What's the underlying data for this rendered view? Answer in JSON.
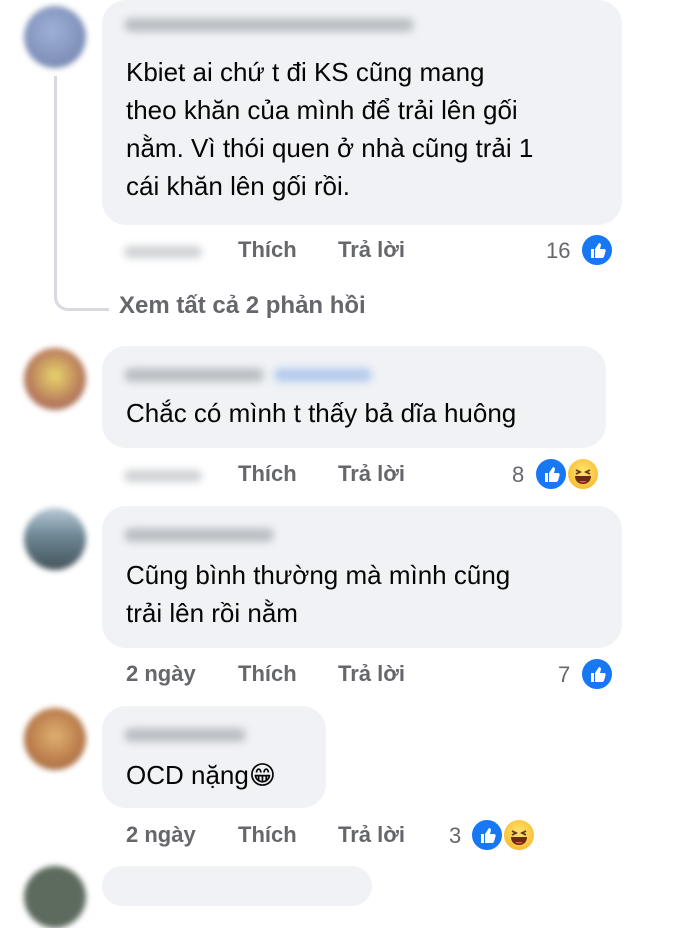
{
  "comments": [
    {
      "text": "Kbiet ai chứ t đi KS cũng mang\ntheo khăn của mình để trải lên gối\nnằm. Vì thói quen ở nhà cũng trải 1\ncái khăn lên gối rồi.",
      "time": "",
      "like_label": "Thích",
      "reply_label": "Trả lời",
      "reactions_count": "16",
      "reactions": [
        "like-icon"
      ]
    },
    {
      "text": "Chắc có mình t thấy bả dĩa huông",
      "time": "",
      "like_label": "Thích",
      "reply_label": "Trả lời",
      "reactions_count": "8",
      "reactions": [
        "like-icon",
        "haha-icon"
      ]
    },
    {
      "text": "Cũng bình thường mà mình cũng\ntrải lên rồi nằm",
      "time": "2 ngày",
      "like_label": "Thích",
      "reply_label": "Trả lời",
      "reactions_count": "7",
      "reactions": [
        "like-icon"
      ]
    },
    {
      "text": "OCD nặng😁",
      "time": "2 ngày",
      "like_label": "Thích",
      "reply_label": "Trả lời",
      "reactions_count": "3",
      "reactions": [
        "like-icon",
        "haha-icon"
      ]
    }
  ],
  "view_replies_label": "Xem tất cả 2 phản hồi",
  "colors": {
    "bubble": "#f0f2f5",
    "meta": "#65676b",
    "like_blue": "#1877f2"
  }
}
